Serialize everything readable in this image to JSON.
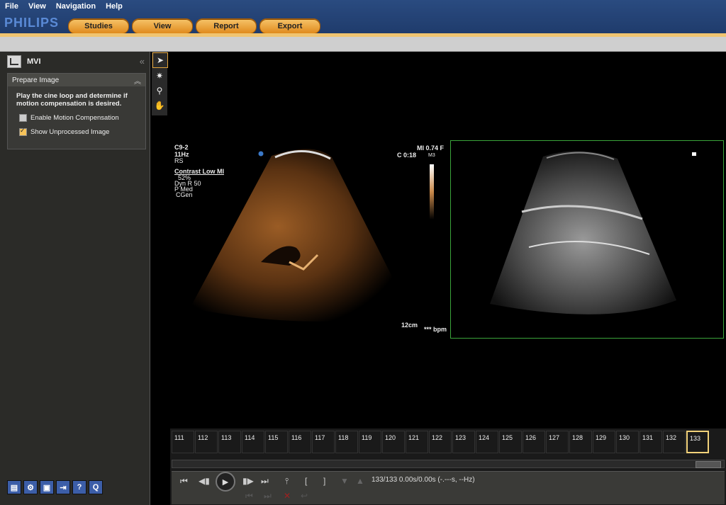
{
  "menu": {
    "items": [
      "File",
      "View",
      "Navigation",
      "Help"
    ]
  },
  "brand": {
    "name": "PHILIPS"
  },
  "tabs": [
    "Studies",
    "View",
    "Report",
    "Export"
  ],
  "panel": {
    "title": "MVI",
    "section_title": "Prepare Image",
    "instructions": "Play the cine loop and determine if motion compensation is desired.",
    "checkbox_motion": "Enable Motion Compensation",
    "checkbox_unprocessed": "Show Unprocessed Image",
    "motion_checked": false,
    "unprocessed_checked": true
  },
  "overlay": {
    "probe": "C9-2",
    "rate": "11Hz",
    "rs": "RS",
    "mode": "Contrast Low MI",
    "gain": "52%",
    "dyn": "Dyn R 50",
    "p": "P Med",
    "cgen": "CGen",
    "c_time": "C 0:18",
    "mi": "MI 0.74 F",
    "m3": "M3",
    "depth": "12cm",
    "bpm": "*** bpm"
  },
  "timeline": {
    "frames": [
      "111",
      "112",
      "113",
      "114",
      "115",
      "116",
      "117",
      "118",
      "119",
      "120",
      "121",
      "122",
      "123",
      "124",
      "125",
      "126",
      "127",
      "128",
      "129",
      "130",
      "131",
      "132",
      "133"
    ],
    "current_frame": "133",
    "status": "133/133  0.00s/0.00s (-.---s, --Hz)"
  }
}
